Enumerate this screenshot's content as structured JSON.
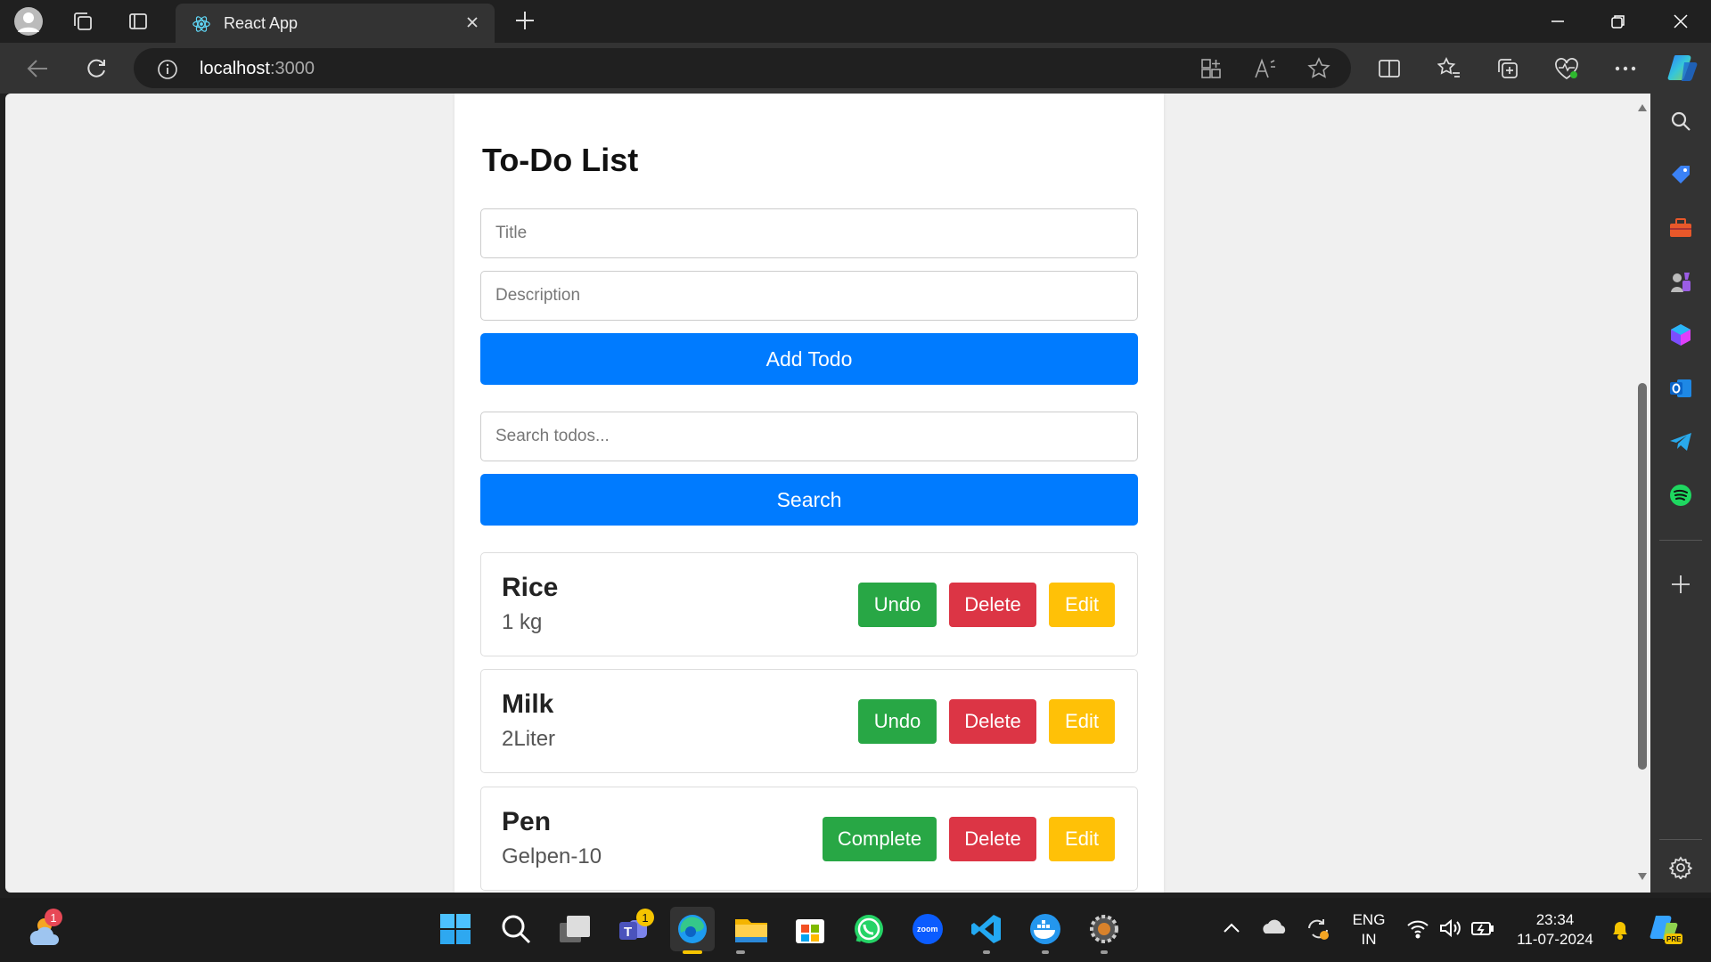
{
  "browser": {
    "tab_title": "React App",
    "url_host": "localhost",
    "url_port": ":3000"
  },
  "app": {
    "heading": "To-Do List",
    "title_placeholder": "Title",
    "description_placeholder": "Description",
    "add_button": "Add Todo",
    "search_placeholder": "Search todos...",
    "search_button": "Search",
    "todos": [
      {
        "title": "Rice",
        "description": "1 kg",
        "toggle_label": "Undo",
        "delete_label": "Delete",
        "edit_label": "Edit"
      },
      {
        "title": "Milk",
        "description": "2Liter",
        "toggle_label": "Undo",
        "delete_label": "Delete",
        "edit_label": "Edit"
      },
      {
        "title": "Pen",
        "description": "Gelpen-10",
        "toggle_label": "Complete",
        "delete_label": "Delete",
        "edit_label": "Edit"
      }
    ]
  },
  "taskbar": {
    "weather_badge": "1",
    "teams_badge": "1",
    "lang_line1": "ENG",
    "lang_line2": "IN",
    "time": "23:34",
    "date": "11-07-2024"
  },
  "colors": {
    "primary": "#007bff",
    "success": "#28a745",
    "danger": "#dc3545",
    "warning": "#ffc107"
  }
}
